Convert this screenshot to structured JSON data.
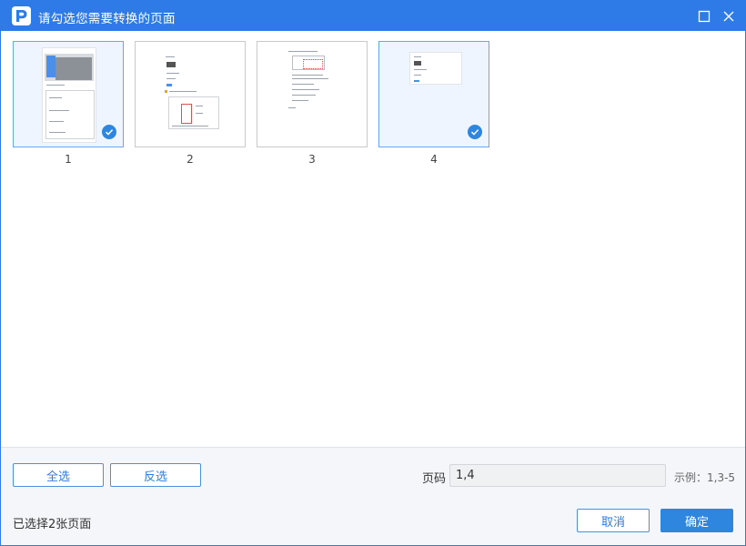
{
  "window": {
    "title": "请勾选您需要转换的页面"
  },
  "pages": [
    {
      "number": "1",
      "selected": true
    },
    {
      "number": "2",
      "selected": false
    },
    {
      "number": "3",
      "selected": false
    },
    {
      "number": "4",
      "selected": true
    }
  ],
  "footer": {
    "select_all_label": "全选",
    "invert_label": "反选",
    "page_range_label": "页码",
    "page_range_value": "1,4",
    "example_hint": "示例：1,3-5",
    "selected_status": "已选择2张页面",
    "cancel_label": "取消",
    "confirm_label": "确定"
  },
  "colors": {
    "accent": "#2e7ae6",
    "check": "#2e86de",
    "selected_bg": "#eff5fe"
  },
  "icons": {
    "app": "app-logo-icon",
    "maximize": "maximize-icon",
    "close": "close-icon",
    "check": "check-icon"
  }
}
